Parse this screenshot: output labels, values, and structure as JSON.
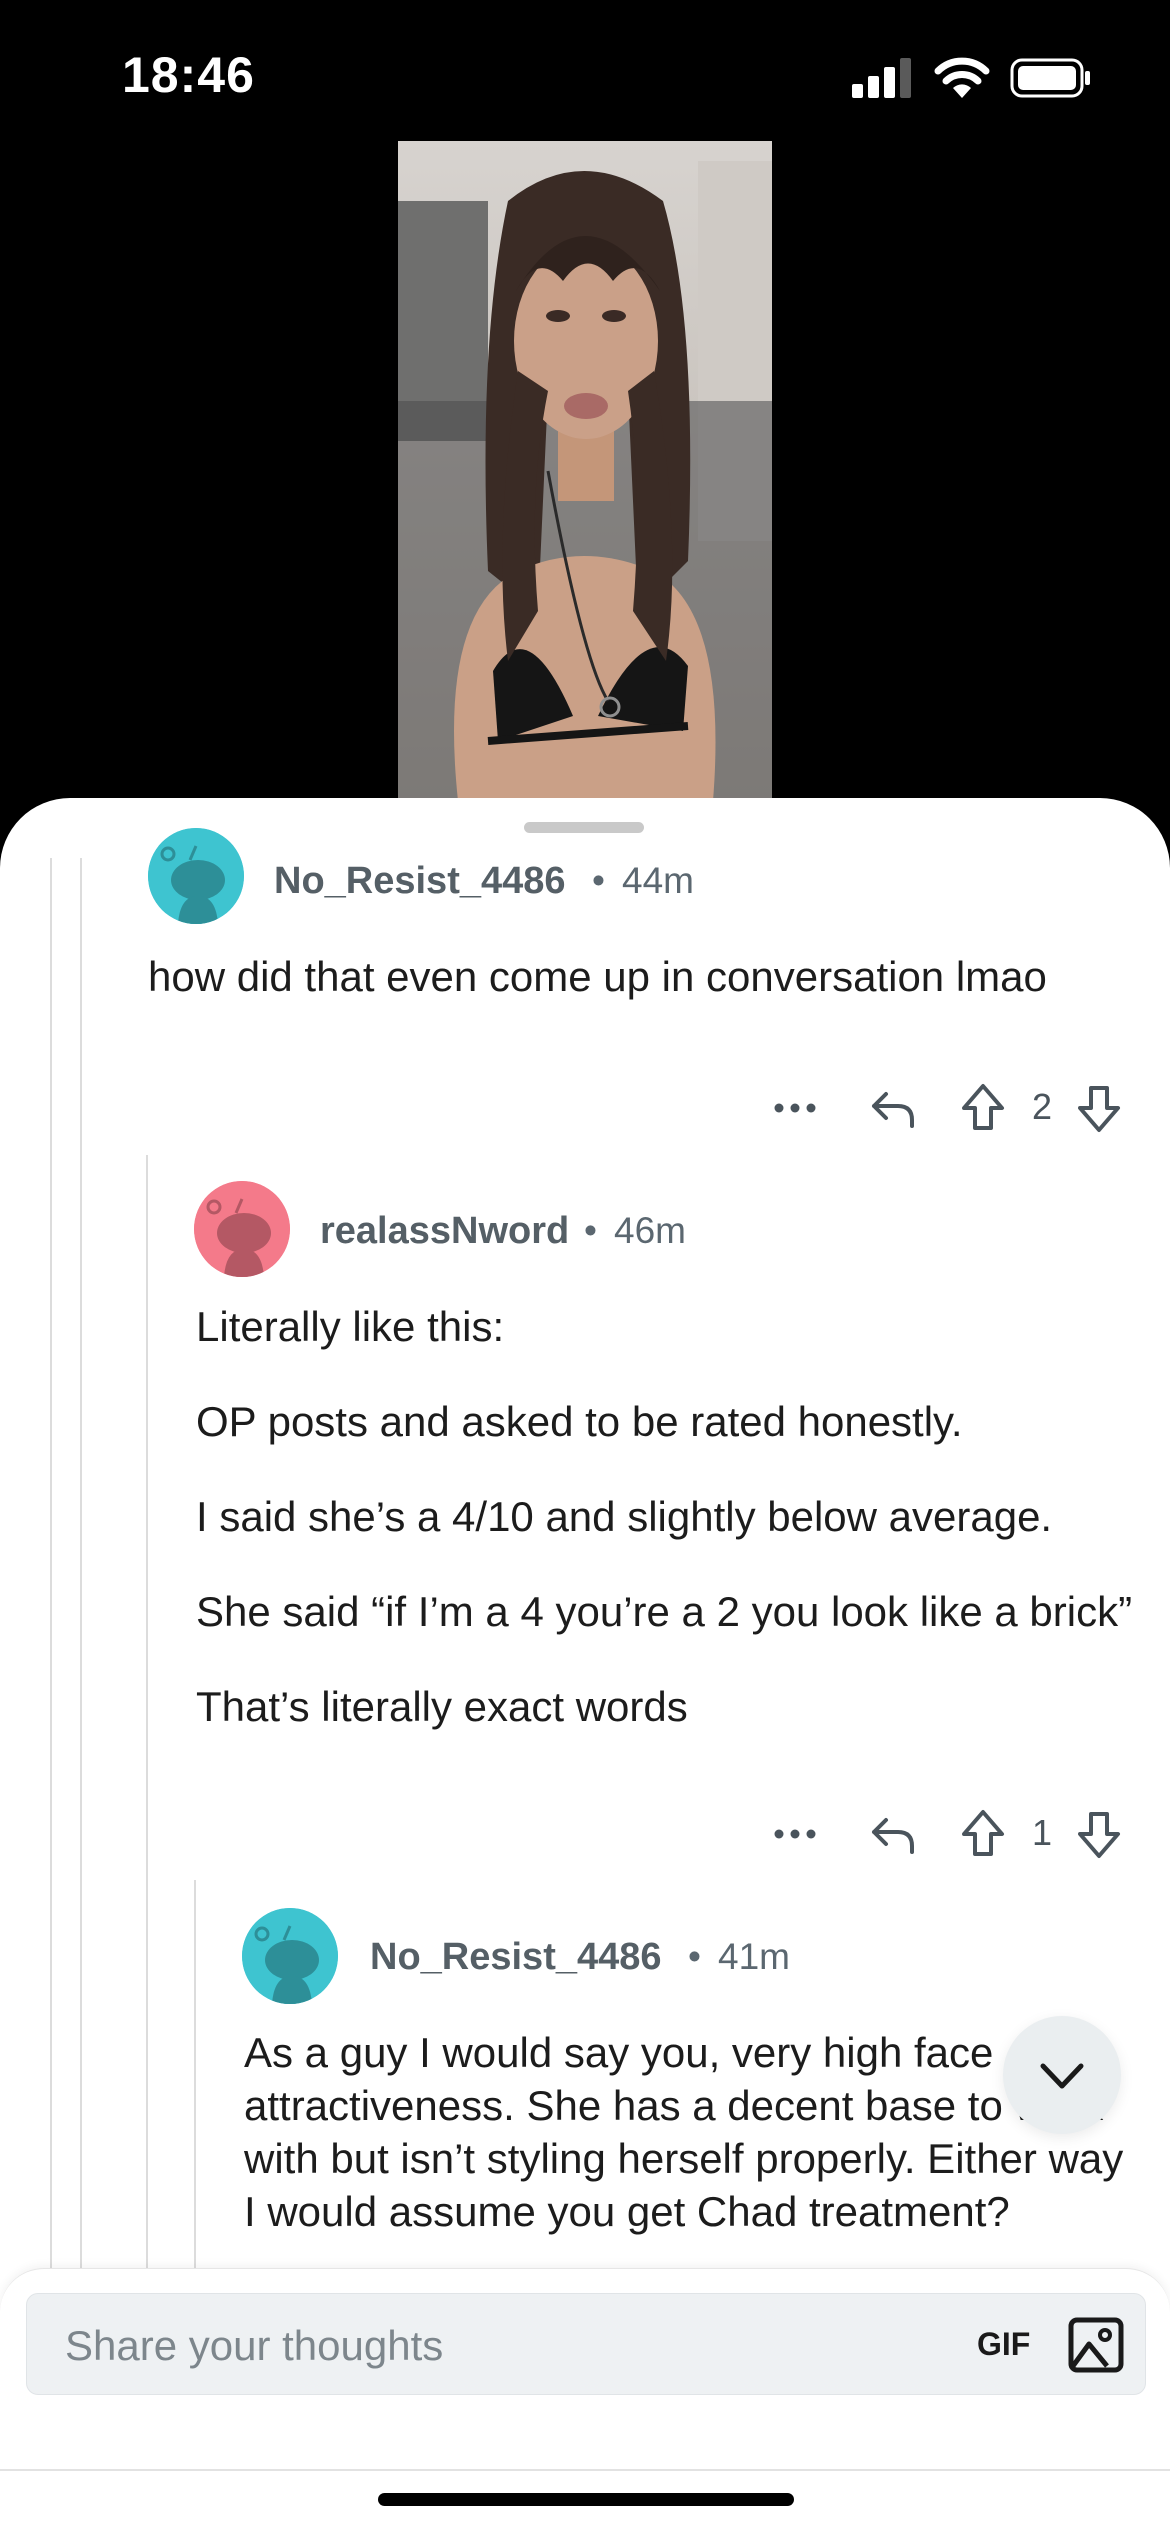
{
  "status_bar": {
    "time": "18:46"
  },
  "post": {
    "media": "portrait selfie image"
  },
  "comments": [
    {
      "username": "No_Resist_4486",
      "age": "44m",
      "paragraphs": [
        "how did that even come up in conversation lmao"
      ],
      "votes": "2",
      "avatar_color": "#3ec4d0"
    },
    {
      "username": "realassNword",
      "age": "46m",
      "paragraphs": [
        "Literally like this:",
        "OP posts and asked to be rated honestly.",
        "I said she’s a 4/10 and slightly below average.",
        "She said “if I’m a 4 you’re a 2 you look like a brick”",
        "That’s literally exact words"
      ],
      "votes": "1",
      "avatar_color": "#f47a8a"
    },
    {
      "username": "No_Resist_4486",
      "age": "41m",
      "paragraphs": [
        "As a guy I would say you, very high face attractiveness. She has a decent base to work with but isn’t styling herself properly. Either way I would assume you get Chad treatment?"
      ],
      "avatar_color": "#3ec4d0"
    }
  ],
  "separator": "•",
  "composer": {
    "placeholder": "Share your thoughts",
    "gif_label": "GIF"
  },
  "icons": {
    "more": "more-dots-icon",
    "reply": "reply-icon",
    "upvote": "upvote-icon",
    "downvote": "downvote-icon",
    "scroll": "chevron-down-icon",
    "image": "image-icon"
  }
}
